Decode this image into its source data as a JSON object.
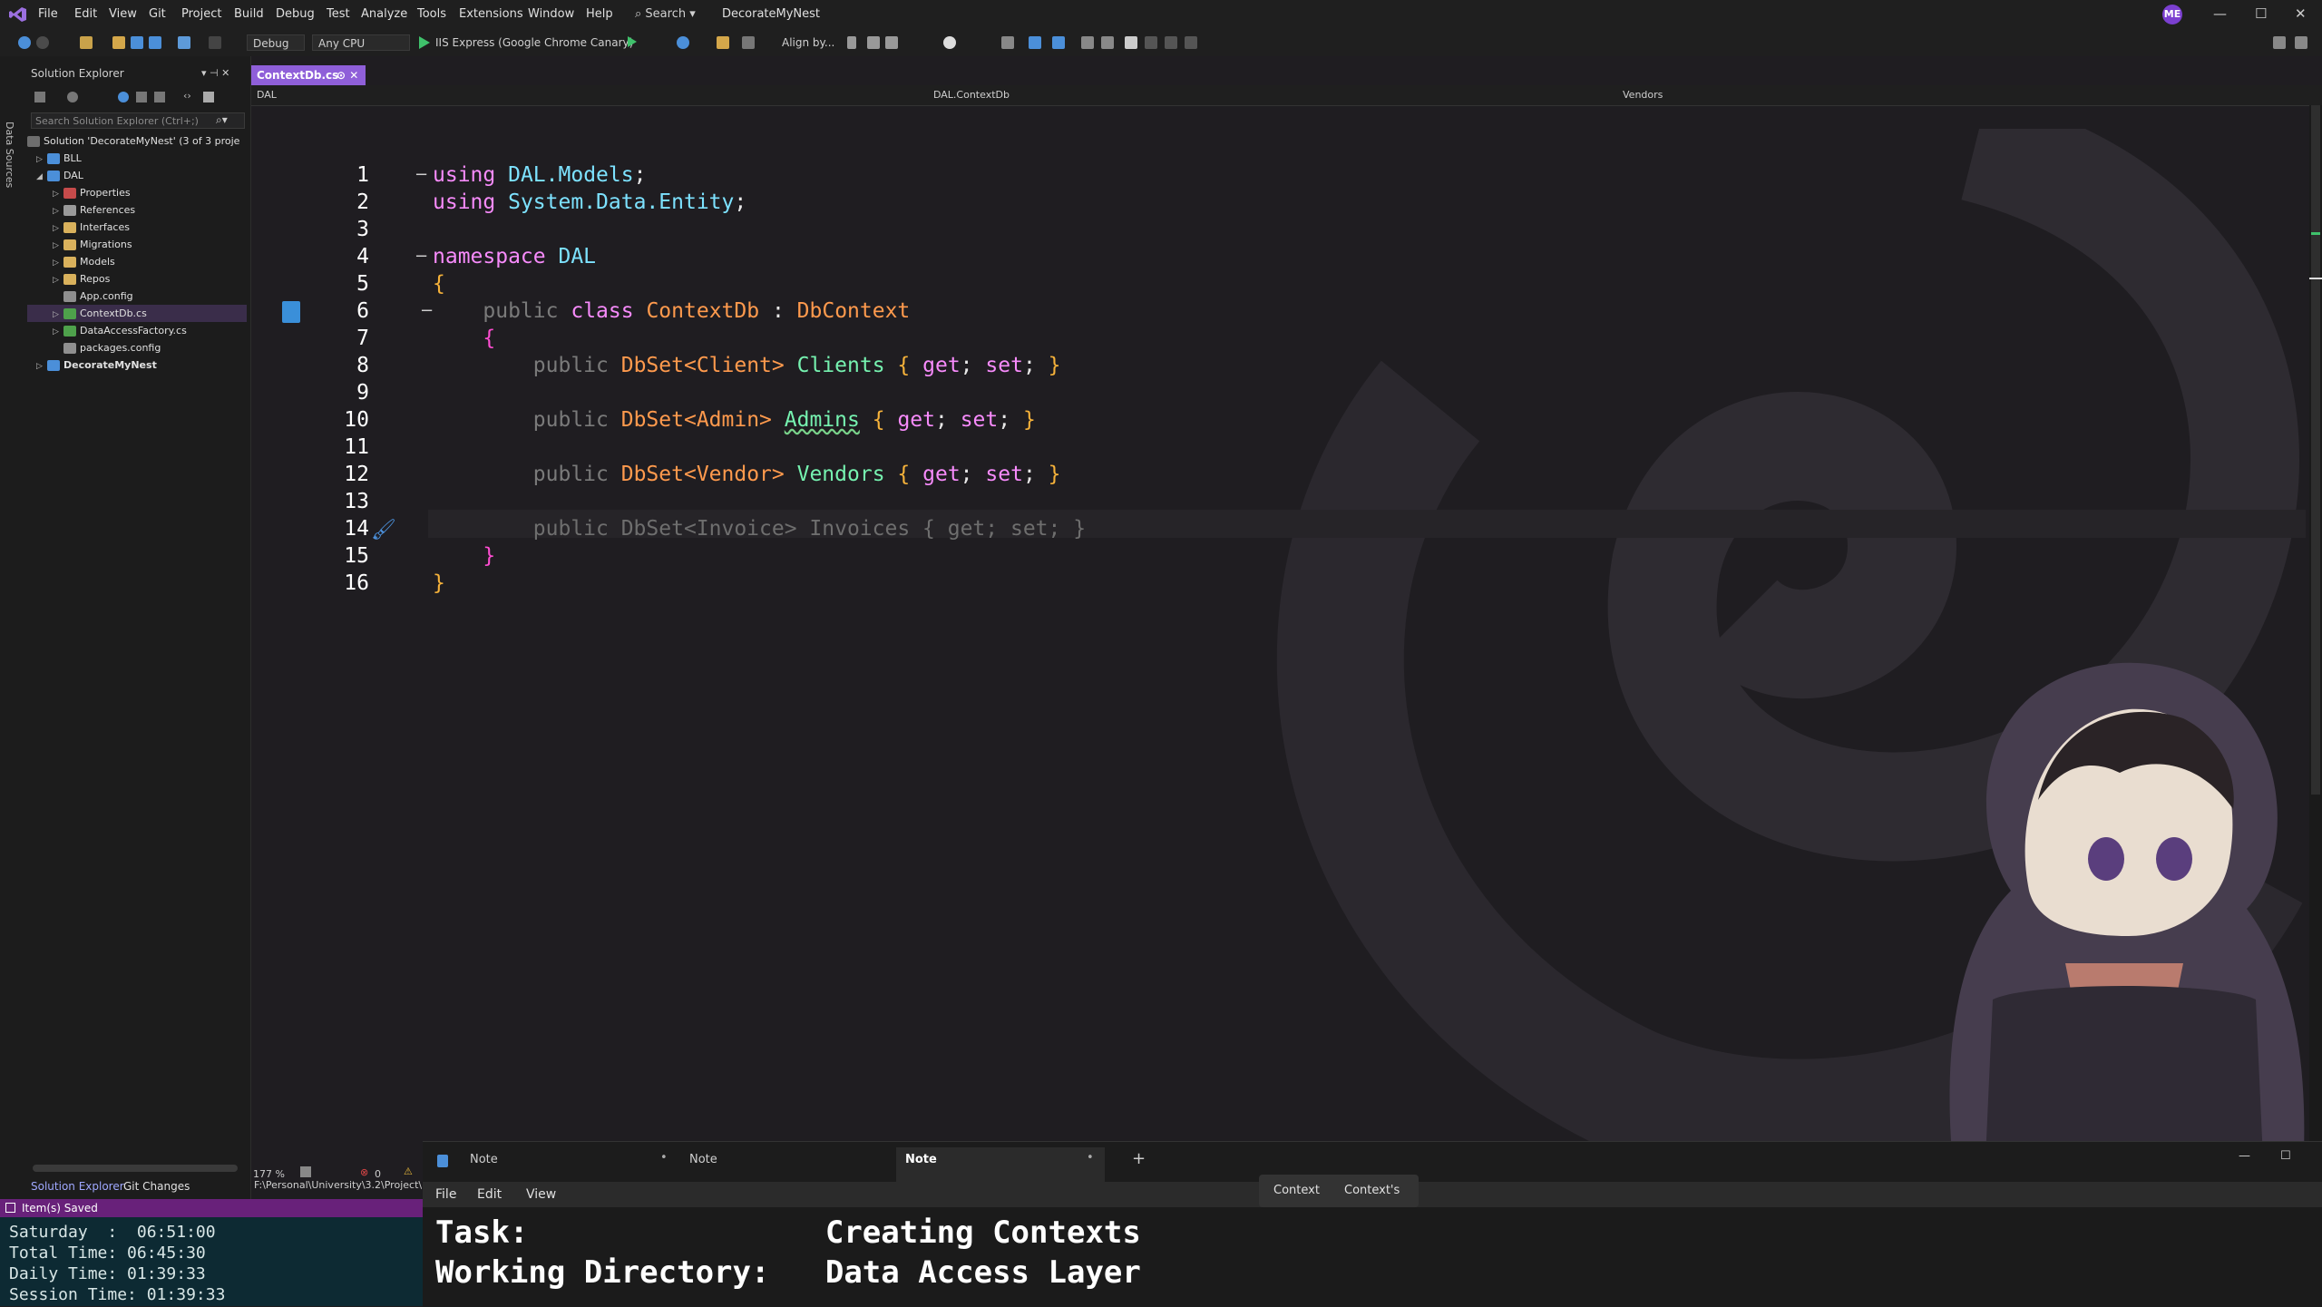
{
  "menu": {
    "items": [
      "File",
      "Edit",
      "View",
      "Git",
      "Project",
      "Build",
      "Debug",
      "Test",
      "Analyze",
      "Tools",
      "Extensions",
      "Window",
      "Help"
    ],
    "search": "Search",
    "solution_name": "DecorateMyNest",
    "user_initials": "ME"
  },
  "toolbar": {
    "config": "Debug",
    "platform": "Any CPU",
    "run_target": "IIS Express (Google Chrome Canary)",
    "align_label": "Align by..."
  },
  "side_strip": {
    "label": "Data Sources"
  },
  "solution_explorer": {
    "title": "Solution Explorer",
    "search_placeholder": "Search Solution Explorer (Ctrl+;)",
    "tree": [
      {
        "label": "Solution 'DecorateMyNest' (3 of 3 proje",
        "level": 0
      },
      {
        "label": "BLL",
        "level": 1
      },
      {
        "label": "DAL",
        "level": 1
      },
      {
        "label": "Properties",
        "level": 2
      },
      {
        "label": "References",
        "level": 2
      },
      {
        "label": "Interfaces",
        "level": 2
      },
      {
        "label": "Migrations",
        "level": 2
      },
      {
        "label": "Models",
        "level": 2
      },
      {
        "label": "Repos",
        "level": 2
      },
      {
        "label": "App.config",
        "level": 2
      },
      {
        "label": "ContextDb.cs",
        "level": 2
      },
      {
        "label": "DataAccessFactory.cs",
        "level": 2
      },
      {
        "label": "packages.config",
        "level": 2
      },
      {
        "label": "DecorateMyNest",
        "level": 1
      }
    ],
    "tabs": [
      "Solution Explorer",
      "Git Changes"
    ]
  },
  "editor": {
    "tab": "ContextDb.cs",
    "nav": {
      "project": "DAL",
      "class": "DAL.ContextDb",
      "member": "Vendors"
    },
    "line_numbers": [
      "1",
      "2",
      "3",
      "4",
      "5",
      "6",
      "7",
      "8",
      "9",
      "10",
      "11",
      "12",
      "13",
      "14",
      "15",
      "16"
    ],
    "code": {
      "l1_kw": "using",
      "l1_ns": "DAL.Models",
      "l1_end": ";",
      "l2_kw": "using",
      "l2_ns": "System.Data.Entity",
      "l2_end": ";",
      "l4_kw": "namespace",
      "l4_ns": "DAL",
      "brace_open": "{",
      "brace_close": "}",
      "l6_public": "public",
      "l6_class": "class",
      "l6_name": "ContextDb",
      "l6_colon": ":",
      "l6_base": "DbContext",
      "prop_public": "public",
      "l8_type": "DbSet<Client>",
      "l8_name": "Clients",
      "l10_type": "DbSet<Admin>",
      "l10_name": "Admins",
      "l12_type": "DbSet<Vendor>",
      "l12_name": "Vendors",
      "l14_full": "public DbSet<Invoice> Invoices { get; set; }",
      "acc_open": "{",
      "acc_get": "get",
      "acc_set": "set",
      "acc_semi": ";",
      "acc_close": "}"
    },
    "zoom": "177 %",
    "errors": "0",
    "path": "F:\\Personal\\University\\3.2\\Project\\"
  },
  "status": {
    "text": "Item(s) Saved"
  },
  "timer": {
    "lines": [
      "Saturday  :  06:51:00",
      "Total Time: 06:45:30",
      "Daily Time: 01:39:33",
      "Session Time: 01:39:33"
    ]
  },
  "notepad": {
    "tabs": [
      "Note",
      "Note",
      "Note"
    ],
    "menu": [
      "File",
      "Edit",
      "View"
    ],
    "find": [
      "Context",
      "Context's"
    ],
    "lines": [
      "Task:                Creating Contexts",
      "Working Directory:   Data Access Layer"
    ]
  },
  "colors": {
    "accent": "#8f5fd9",
    "statusbar": "#68217a",
    "keyword": "#f78bfb",
    "type": "#ff9a4d",
    "identifier": "#76f2b0"
  }
}
